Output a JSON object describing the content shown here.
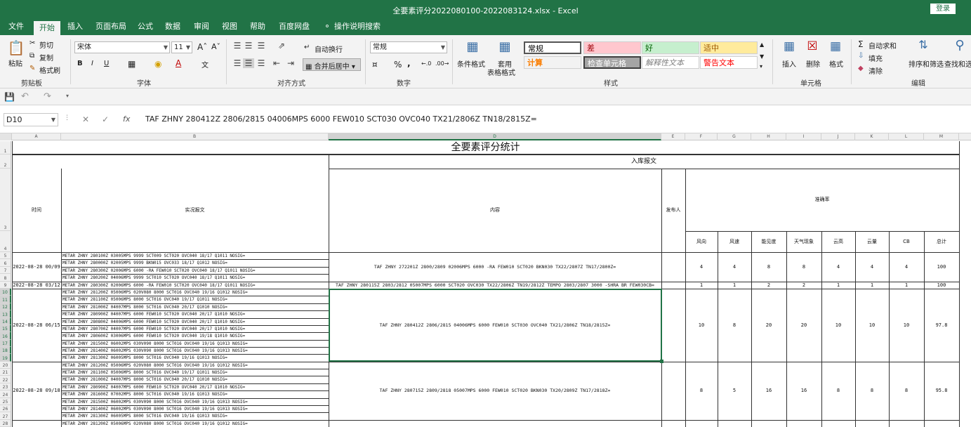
{
  "window": {
    "title": "全要素评分2022080100-2022083124.xlsx - Excel",
    "login": "登录"
  },
  "tabs": [
    "文件",
    "开始",
    "插入",
    "页面布局",
    "公式",
    "数据",
    "审阅",
    "视图",
    "帮助",
    "百度网盘",
    "操作说明搜索"
  ],
  "ribbon": {
    "clipboard": {
      "paste": "粘贴",
      "cut": "剪切",
      "copy": "复制",
      "format_painter": "格式刷",
      "label": "剪贴板"
    },
    "font": {
      "name": "宋体",
      "size": "11",
      "label": "字体",
      "bold": "B",
      "italic": "I",
      "underline": "U"
    },
    "alignment": {
      "wrap": "自动换行",
      "merge": "合并后居中",
      "label": "对齐方式"
    },
    "number": {
      "format": "常规",
      "percent": "%",
      "comma": ",",
      "label": "数字"
    },
    "styles": {
      "conditional": "条件格式",
      "table_line1": "套用",
      "table_line2": "表格格式",
      "label": "样式",
      "gallery": [
        {
          "text": "常规",
          "bg": "#ffffff",
          "fg": "#000000"
        },
        {
          "text": "差",
          "bg": "#ffc7ce",
          "fg": "#9c0006"
        },
        {
          "text": "好",
          "bg": "#c6efce",
          "fg": "#006100"
        },
        {
          "text": "适中",
          "bg": "#ffeb9c",
          "fg": "#9c5700"
        },
        {
          "text": "计算",
          "bg": "#f2f2f2",
          "fg": "#fa7d00"
        },
        {
          "text": "检查单元格",
          "bg": "#a5a5a5",
          "fg": "#ffffff"
        },
        {
          "text": "解释性文本",
          "bg": "#ffffff",
          "fg": "#7f7f7f"
        },
        {
          "text": "警告文本",
          "bg": "#ffffff",
          "fg": "#ff0000"
        }
      ]
    },
    "cells": {
      "insert": "插入",
      "delete": "删除",
      "format": "格式",
      "label": "单元格"
    },
    "editing": {
      "autosum": "自动求和",
      "fill": "填充",
      "clear": "清除",
      "sort": "排序和筛选",
      "find": "查找和选",
      "label": "编辑"
    }
  },
  "formula_bar": {
    "name_box": "D10",
    "fx": "fx",
    "content": "TAF ZHNY 280412Z 2806/2815 04006MPS 6000 FEW010 SCT030 OVC040 TX21/2806Z TN18/2815Z="
  },
  "columns": [
    "A",
    "B",
    "C",
    "D",
    "E",
    "F",
    "G",
    "H",
    "I",
    "J",
    "K",
    "L",
    "M"
  ],
  "rows": [
    "1",
    "2",
    "3",
    "4",
    "5",
    "6",
    "7",
    "8",
    "9",
    "10",
    "11",
    "12",
    "13",
    "14",
    "15",
    "16",
    "17",
    "18",
    "19",
    "20",
    "21",
    "22",
    "23",
    "24",
    "25",
    "26",
    "27",
    "28"
  ],
  "sheet": {
    "title": "全要素评分统计",
    "inbound_header": "入库报文",
    "time_header": "时间",
    "obs_header": "实况报文",
    "content_header": "内容",
    "publisher_header": "发布人",
    "accuracy_header": "准确率",
    "sub_headers": [
      "风向",
      "风速",
      "能见度",
      "天气现象",
      "云高",
      "云量",
      "CB",
      "总计"
    ],
    "groups": [
      {
        "time": "2022-08-28 00/09",
        "taf": "TAF ZHNY 272201Z 2800/2809 02006MPS 6000 -RA FEW010 SCT020 BKN030 TX22/2807Z TN17/2800Z=",
        "scores": [
          "4",
          "4",
          "8",
          "8",
          "4",
          "4",
          "4",
          "100"
        ],
        "metars": [
          "METAR ZHNY 280100Z 03005MPS 9999 SCT009 SCT020 OVC040 18/17 Q1011 NOSIG=",
          "METAR ZHNY 280000Z 02005MPS 9999 BKN015 OVC033 18/17 Q1012 NOSIG=",
          "METAR ZHNY 280300Z 02006MPS 6000 -RA FEW010 SCT020 OVC040 18/17 Q1011 NOSIG=",
          "METAR ZHNY 280200Z 04006MPS 9999 SCT010 SCT020 OVC040 18/17 Q1011 NOSIG="
        ]
      },
      {
        "time": "2022-08-28 03/12",
        "taf": "TAF ZHNY 280115Z 2803/2812 05007MPS 6000 SCT020 OVC030 TX22/2806Z TN19/2812Z TEMPO 2803/2807 3000 -SHRA BR FEW030CB=",
        "scores": [
          "1",
          "1",
          "2",
          "2",
          "1",
          "1",
          "1",
          "100"
        ],
        "metars": [
          "METAR ZHNY 280300Z 02006MPS 6000 -RA FEW010 SCT020 OVC040 18/17 Q1011 NOSIG="
        ]
      },
      {
        "time": "2022-08-28 06/15",
        "taf": "TAF ZHNY 280412Z 2806/2815 04006MPS 6000 FEW010 SCT030 OVC040 TX21/2806Z TN18/2815Z=",
        "scores": [
          "10",
          "8",
          "20",
          "20",
          "10",
          "10",
          "10",
          "97.8"
        ],
        "metars": [
          "METAR ZHNY 281200Z 05006MPS 020V080 8000 SCT016 OVC040 19/16 Q1012 NOSIG=",
          "METAR ZHNY 281100Z 05006MPS 8000 SCT016 OVC040 19/17 Q1011 NOSIG=",
          "METAR ZHNY 281000Z 04007MPS 8000 SCT016 OVC040 20/17 Q1010 NOSIG=",
          "METAR ZHNY 280900Z 04007MPS 6000 FEW010 SCT020 OVC040 20/17 Q1010 NOSIG=",
          "METAR ZHNY 280800Z 04006MPS 6000 FEW010 SCT020 OVC040 20/17 Q1010 NOSIG=",
          "METAR ZHNY 280700Z 04007MPS 6000 FEW010 SCT020 OVC040 20/17 Q1010 NOSIG=",
          "METAR ZHNY 280600Z 03006MPS 6000 FEW010 SCT020 OVC040 19/18 Q1010 NOSIG=",
          "METAR ZHNY 281500Z 06002MPS 030V090 8000 SCT016 OVC040 19/16 Q1013 NOSIG=",
          "METAR ZHNY 281400Z 06002MPS 030V090 8000 SCT016 OVC040 19/16 Q1013 NOSIG=",
          "METAR ZHNY 281300Z 06005MPS 8000 SCT016 OVC040 19/16 Q1013 NOSIG="
        ]
      },
      {
        "time": "2022-08-28 09/18",
        "taf": "TAF ZHNY 280715Z 2809/2818 05007MPS 6000 FEW010 SCT020 BKN030 TX20/2809Z TN17/2818Z=",
        "scores": [
          "8",
          "5",
          "16",
          "16",
          "8",
          "8",
          "8",
          "95.8"
        ],
        "metars": [
          "METAR ZHNY 281200Z 05006MPS 020V080 8000 SCT016 OVC040 19/16 Q1012 NOSIG=",
          "METAR ZHNY 281100Z 05006MPS 8000 SCT016 OVC040 19/17 Q1011 NOSIG=",
          "METAR ZHNY 281000Z 04007MPS 8000 SCT016 OVC040 20/17 Q1010 NOSIG=",
          "METAR ZHNY 280900Z 04007MPS 6000 FEW010 SCT020 OVC040 20/17 Q1010 NOSIG=",
          "METAR ZHNY 281600Z 07002MPS 8000 SCT016 OVC040 19/16 Q1013 NOSIG=",
          "METAR ZHNY 281500Z 06002MPS 030V090 8000 SCT016 OVC040 19/16 Q1013 NOSIG=",
          "METAR ZHNY 281400Z 06002MPS 030V090 8000 SCT016 OVC040 19/16 Q1013 NOSIG=",
          "METAR ZHNY 281300Z 06005MPS 8000 SCT016 OVC040 19/16 Q1013 NOSIG="
        ]
      },
      {
        "time": "",
        "taf": "",
        "scores": [],
        "metars": [
          "METAR ZHNY 281200Z 05006MPS 020V080 8000 SCT016 OVC040 19/16 Q1012 NOSIG="
        ]
      }
    ]
  }
}
